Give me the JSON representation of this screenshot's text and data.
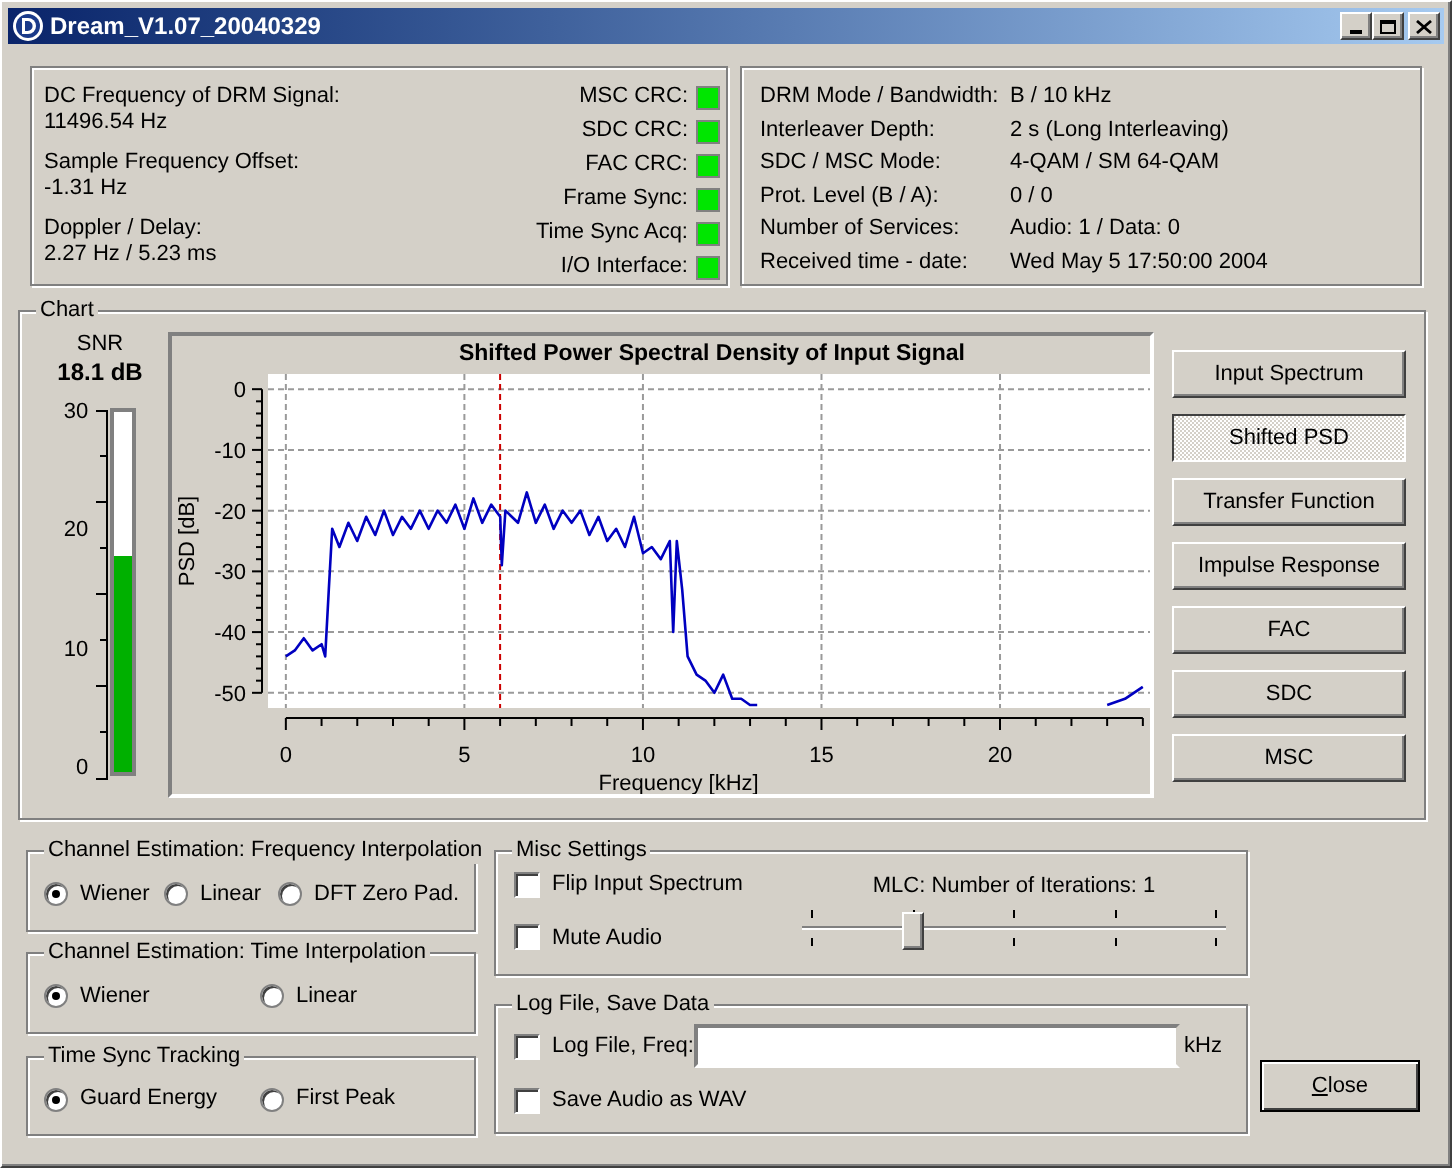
{
  "window": {
    "title": "Dream_V1.07_20040329"
  },
  "signal_info": [
    {
      "label": "DC Frequency of DRM Signal:",
      "value": "11496.54 Hz"
    },
    {
      "label": "Sample Frequency Offset:",
      "value": "-1.31 Hz"
    },
    {
      "label": "Doppler / Delay:",
      "value": "2.27 Hz / 5.23 ms"
    }
  ],
  "indicators": [
    {
      "label": "MSC CRC:",
      "color": "#00e600"
    },
    {
      "label": "SDC CRC:",
      "color": "#00e600"
    },
    {
      "label": "FAC CRC:",
      "color": "#00e600"
    },
    {
      "label": "Frame Sync:",
      "color": "#00e600"
    },
    {
      "label": "Time Sync Acq:",
      "color": "#00e600"
    },
    {
      "label": "I/O Interface:",
      "color": "#00e600"
    }
  ],
  "parameters": [
    {
      "label": "DRM Mode / Bandwidth:",
      "value": "B / 10 kHz"
    },
    {
      "label": "Interleaver Depth:",
      "value": "2 s (Long Interleaving)"
    },
    {
      "label": "SDC / MSC Mode:",
      "value": "4-QAM / SM 64-QAM"
    },
    {
      "label": "Prot. Level (B / A):",
      "value": "0 / 0"
    },
    {
      "label": "Number of Services:",
      "value": "Audio: 1 / Data: 0"
    },
    {
      "label": "Received time - date:",
      "value": "Wed May 5 17:50:00 2004"
    }
  ],
  "chart": {
    "title": "Chart",
    "snr": {
      "label": "SNR",
      "value": "18.1 dB",
      "ticks": [
        "30",
        "20",
        "10",
        "0"
      ],
      "level": 0.6
    },
    "chart_data": {
      "type": "line",
      "title": "Shifted Power Spectral Density of Input Signal",
      "xlabel": "Frequency [kHz]",
      "ylabel": "PSD [dB]",
      "xlim": [
        -0.5,
        24.2
      ],
      "ylim": [
        -52.5,
        2.5
      ],
      "xticks": [
        0,
        5,
        10,
        15,
        20
      ],
      "yticks": [
        0,
        -10,
        -20,
        -30,
        -40,
        -50
      ],
      "grid": true,
      "x": [
        0,
        0.25,
        0.5,
        0.75,
        1,
        1.1,
        1.2,
        1.3,
        1.5,
        1.75,
        2,
        2.25,
        2.5,
        2.75,
        3,
        3.25,
        3.5,
        3.75,
        4,
        4.25,
        4.5,
        4.75,
        5,
        5.25,
        5.5,
        5.75,
        6,
        6.05,
        6.15,
        6.5,
        6.75,
        7,
        7.25,
        7.5,
        7.75,
        8,
        8.25,
        8.5,
        8.75,
        9,
        9.25,
        9.5,
        9.75,
        10,
        10.25,
        10.5,
        10.75,
        10.85,
        10.95,
        11.1,
        11.25,
        11.5,
        11.75,
        12,
        12.25,
        12.5,
        12.75,
        13,
        13.2,
        23,
        23.5,
        24
      ],
      "series": [
        {
          "color": "#0000c0",
          "values": [
            -44,
            -43,
            -41,
            -43,
            -42,
            -44,
            -33,
            -23,
            -26,
            -22,
            -25,
            -21,
            -24,
            -20,
            -24,
            -21,
            -23,
            -20,
            -23,
            -20,
            -22,
            -19,
            -23,
            -18,
            -22,
            -19,
            -21,
            -29,
            -20,
            -22,
            -17,
            -22,
            -19,
            -23,
            -20,
            -22,
            -20,
            -24,
            -21,
            -25,
            -23,
            -26,
            -21,
            -27,
            -26,
            -28,
            -25,
            -40,
            -25,
            -33,
            -44,
            -47,
            -48,
            -50,
            -47,
            -51,
            -51,
            -52,
            -52,
            null,
            null,
            null
          ]
        },
        {
          "color": "#0000c0",
          "values": [
            null,
            null,
            null,
            null,
            null,
            null,
            null,
            null,
            null,
            null,
            null,
            null,
            null,
            null,
            null,
            null,
            null,
            null,
            null,
            null,
            null,
            null,
            null,
            null,
            null,
            null,
            null,
            null,
            null,
            null,
            null,
            null,
            null,
            null,
            null,
            null,
            null,
            null,
            null,
            null,
            null,
            null,
            null,
            null,
            null,
            null,
            null,
            null,
            null,
            null,
            null,
            null,
            null,
            null,
            null,
            null,
            null,
            null,
            null,
            -52,
            -51,
            -49
          ]
        }
      ],
      "ref_lines": [
        {
          "axis": "x",
          "value": 6,
          "color": "#cc0000"
        }
      ]
    },
    "buttons": [
      {
        "label": "Input Spectrum",
        "selected": false
      },
      {
        "label": "Shifted PSD",
        "selected": true
      },
      {
        "label": "Transfer Function",
        "selected": false
      },
      {
        "label": "Impulse Response",
        "selected": false
      },
      {
        "label": "FAC",
        "selected": false
      },
      {
        "label": "SDC",
        "selected": false
      },
      {
        "label": "MSC",
        "selected": false
      }
    ]
  },
  "frequency_interpolation": {
    "title": "Channel Estimation: Frequency Interpolation",
    "options": [
      {
        "label": "Wiener",
        "selected": true
      },
      {
        "label": "Linear",
        "selected": false
      },
      {
        "label": "DFT Zero Pad.",
        "selected": false
      }
    ]
  },
  "time_interpolation": {
    "title": "Channel Estimation: Time Interpolation",
    "options": [
      {
        "label": "Wiener",
        "selected": true
      },
      {
        "label": "Linear",
        "selected": false
      }
    ]
  },
  "time_sync_tracking": {
    "title": "Time Sync Tracking",
    "options": [
      {
        "label": "Guard Energy",
        "selected": true
      },
      {
        "label": "First Peak",
        "selected": false
      }
    ]
  },
  "misc_settings": {
    "title": "Misc Settings",
    "checkboxes": [
      {
        "label": "Flip Input Spectrum",
        "checked": false
      },
      {
        "label": "Mute Audio",
        "checked": false
      }
    ],
    "slider": {
      "label": "MLC: Number of Iterations: 1",
      "level": 0.25
    }
  },
  "log_file": {
    "title": "Log File, Save Data",
    "log_checkbox": {
      "label": "Log File, Freq:",
      "checked": false
    },
    "unit": "kHz",
    "save_checkbox": {
      "label": "Save Audio as WAV",
      "checked": false
    }
  },
  "close_button": {
    "label": "Close"
  }
}
